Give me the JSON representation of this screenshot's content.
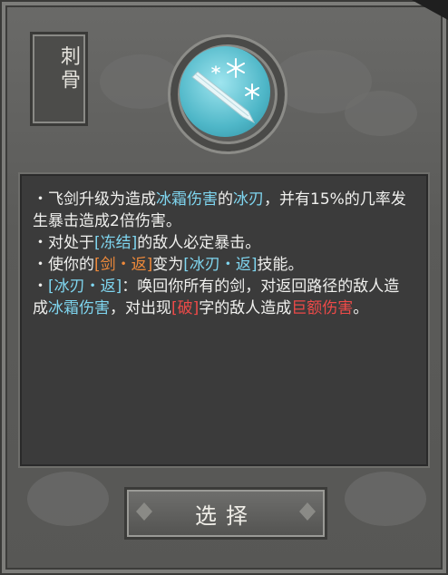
{
  "skill": {
    "title": "刺骨",
    "icon": "ice-sword-icon"
  },
  "description": {
    "line1": [
      {
        "t": "・飞剑升级为造成",
        "c": "white"
      },
      {
        "t": "冰霜伤害",
        "c": "blue"
      },
      {
        "t": "的",
        "c": "white"
      },
      {
        "t": "冰刃",
        "c": "blue"
      },
      {
        "t": "，并有15%的几率发生暴击造成2倍伤害。",
        "c": "white"
      }
    ],
    "line2": [
      {
        "t": "・对处于",
        "c": "white"
      },
      {
        "t": "[冻结]",
        "c": "blue"
      },
      {
        "t": "的敌人必定暴击。",
        "c": "white"
      }
    ],
    "line3": [
      {
        "t": "・使你的",
        "c": "white"
      },
      {
        "t": "[剑・返]",
        "c": "orange"
      },
      {
        "t": "变为",
        "c": "white"
      },
      {
        "t": "[冰刃・返]",
        "c": "blue"
      },
      {
        "t": "技能。",
        "c": "white"
      }
    ],
    "line4": [
      {
        "t": "・",
        "c": "white"
      },
      {
        "t": "[冰刃・返]",
        "c": "blue"
      },
      {
        "t": "：唤回你所有的剑，对返回路径的敌人造成",
        "c": "white"
      },
      {
        "t": "冰霜伤害",
        "c": "blue"
      },
      {
        "t": "，对出现",
        "c": "white"
      },
      {
        "t": "[破]",
        "c": "red"
      },
      {
        "t": "字的敌人造成",
        "c": "white"
      },
      {
        "t": "巨额伤害",
        "c": "red"
      },
      {
        "t": "。",
        "c": "white"
      }
    ]
  },
  "button": {
    "select_label": "选择"
  },
  "colors": {
    "white": "#f0f0ee",
    "blue": "#7fd6f0",
    "orange": "#f08a3a",
    "red": "#ef4a48"
  }
}
